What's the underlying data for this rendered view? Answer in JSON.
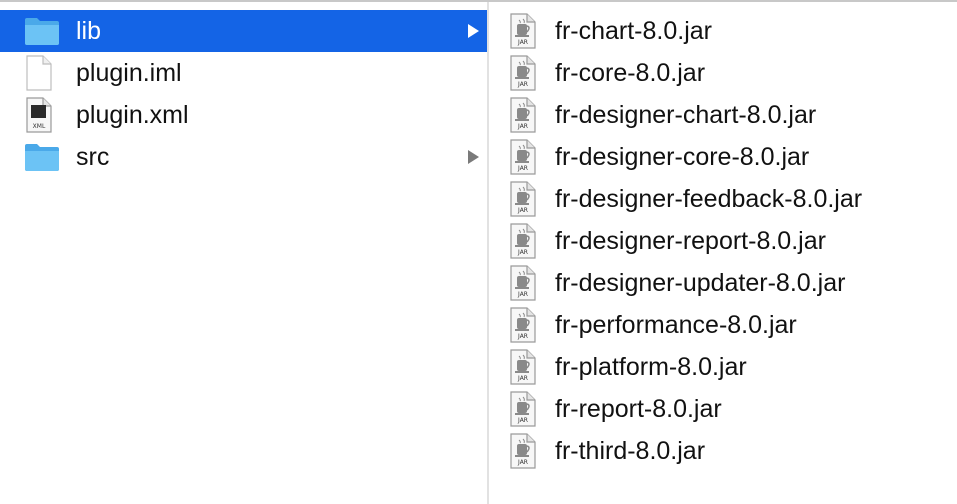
{
  "column1": {
    "items": [
      {
        "label": "lib",
        "icon": "folder-icon",
        "selected": true,
        "has_children": true
      },
      {
        "label": "plugin.iml",
        "icon": "document-icon",
        "selected": false,
        "has_children": false
      },
      {
        "label": "plugin.xml",
        "icon": "xml-file-icon",
        "selected": false,
        "has_children": false
      },
      {
        "label": "src",
        "icon": "folder-icon",
        "selected": false,
        "has_children": true
      }
    ]
  },
  "column2": {
    "items": [
      {
        "label": "fr-chart-8.0.jar",
        "icon": "jar-file-icon"
      },
      {
        "label": "fr-core-8.0.jar",
        "icon": "jar-file-icon"
      },
      {
        "label": "fr-designer-chart-8.0.jar",
        "icon": "jar-file-icon"
      },
      {
        "label": "fr-designer-core-8.0.jar",
        "icon": "jar-file-icon"
      },
      {
        "label": "fr-designer-feedback-8.0.jar",
        "icon": "jar-file-icon"
      },
      {
        "label": "fr-designer-report-8.0.jar",
        "icon": "jar-file-icon"
      },
      {
        "label": "fr-designer-updater-8.0.jar",
        "icon": "jar-file-icon"
      },
      {
        "label": "fr-performance-8.0.jar",
        "icon": "jar-file-icon"
      },
      {
        "label": "fr-platform-8.0.jar",
        "icon": "jar-file-icon"
      },
      {
        "label": "fr-report-8.0.jar",
        "icon": "jar-file-icon"
      },
      {
        "label": "fr-third-8.0.jar",
        "icon": "jar-file-icon"
      }
    ]
  },
  "icon_text": {
    "jar": "JAR",
    "xml": "XML"
  },
  "colors": {
    "selection": "#1464e6",
    "folder": "#5cb8f0",
    "disclosure": "#7a7a7a"
  }
}
